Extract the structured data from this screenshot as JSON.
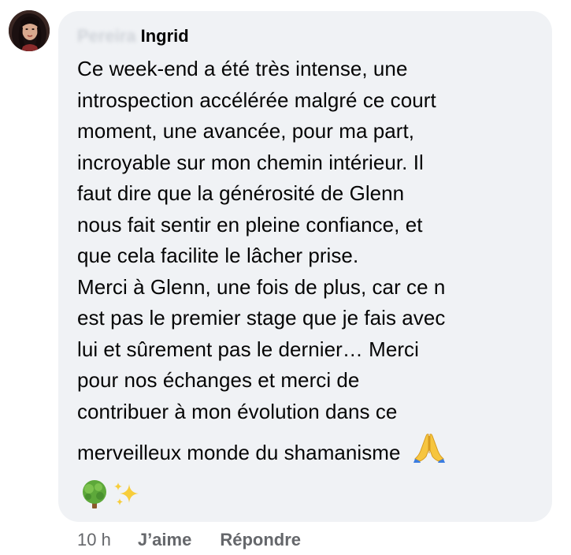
{
  "comment": {
    "author_name": "Ingrid",
    "author_surname_redacted": "Pereira",
    "text_lines": [
      "Ce week-end a été très intense, une",
      "introspection accélérée malgré ce court",
      "moment, une avancée, pour ma part,",
      "incroyable sur mon chemin intérieur. Il",
      "faut dire que la générosité de Glenn",
      "nous fait sentir en pleine confiance, et",
      "que cela facilite le lâcher prise.",
      "Merci à Glenn, une fois de plus, car ce n",
      "est pas le premier stage que je fais avec",
      "lui et sûrement pas le dernier… Merci",
      "pour nos échanges et merci de",
      "contribuer à mon évolution dans ce",
      "merveilleux monde du shamanisme"
    ],
    "emojis": {
      "after_text": "folded-hands-icon",
      "footer": [
        "tree-icon",
        "sparkles-icon"
      ]
    },
    "bubble_color": "#f0f2f5"
  },
  "actions": {
    "time": "10 h",
    "like_label": "J’aime",
    "reply_label": "Répondre"
  }
}
